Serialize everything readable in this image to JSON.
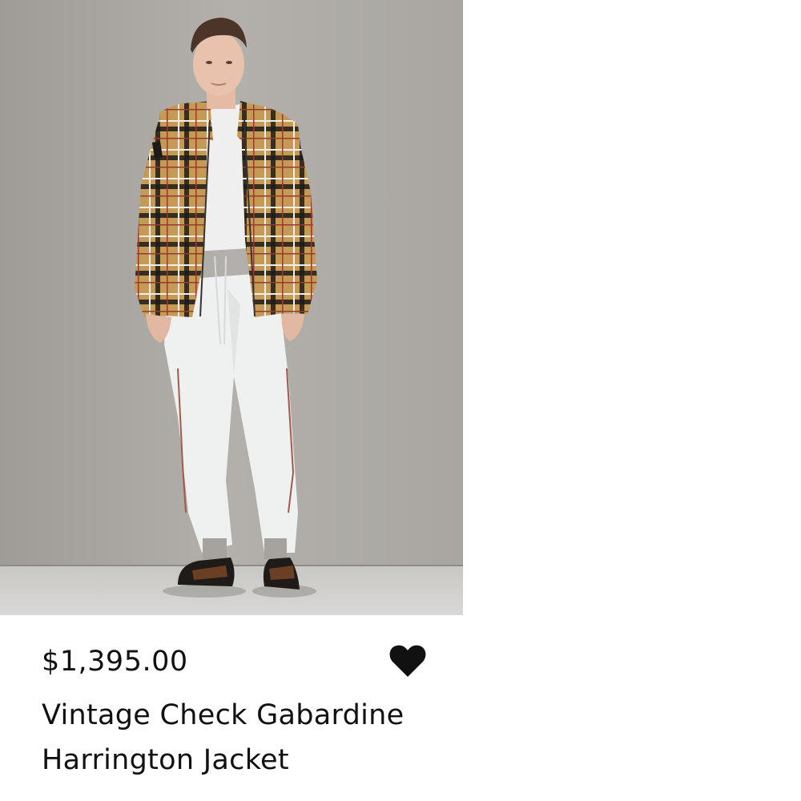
{
  "product": {
    "price": "$1,395.00",
    "name": "Vintage Check Gabardine Harrington Jacket",
    "image_icon": "product-photo",
    "favorite_icon": "heart-icon",
    "favorite_color": "#111111"
  }
}
